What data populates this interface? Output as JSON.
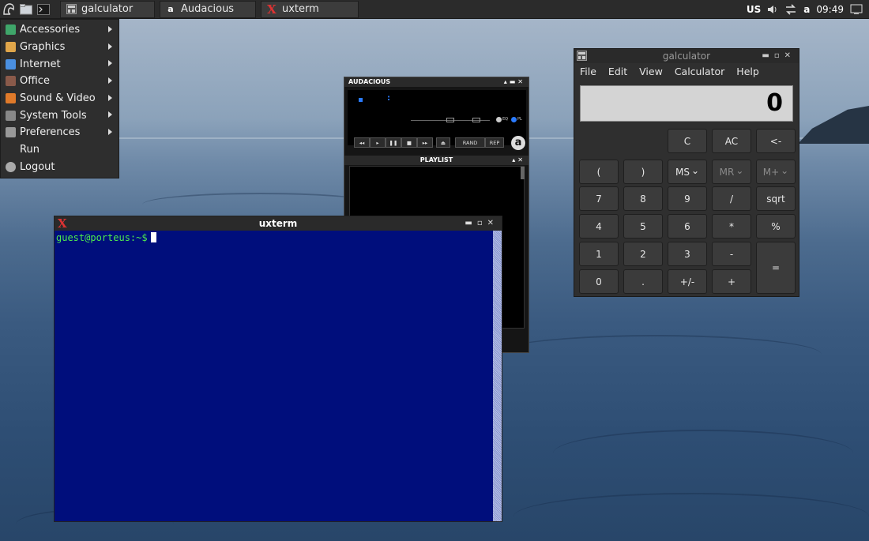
{
  "taskbar": {
    "tasks": [
      {
        "label": "galculator",
        "icon": "galculator-icon"
      },
      {
        "label": "Audacious",
        "icon": "audacious-icon",
        "glyph": "a"
      },
      {
        "label": "uxterm",
        "icon": "x-icon",
        "glyph": "X"
      }
    ],
    "keyboard_layout": "US",
    "tray_audacious_glyph": "a",
    "clock": "09:49"
  },
  "start_menu": {
    "items": [
      {
        "label": "Accessories",
        "submenu": true,
        "color": "#3fa66a"
      },
      {
        "label": "Graphics",
        "submenu": true,
        "color": "#e0a64a"
      },
      {
        "label": "Internet",
        "submenu": true,
        "color": "#4a8fe0"
      },
      {
        "label": "Office",
        "submenu": true,
        "color": "#8a5a4a"
      },
      {
        "label": "Sound & Video",
        "submenu": true,
        "color": "#e07a2a"
      },
      {
        "label": "System Tools",
        "submenu": true,
        "color": "#888888"
      },
      {
        "label": "Preferences",
        "submenu": true,
        "color": "#999999"
      },
      {
        "label": "Run",
        "submenu": false,
        "color": ""
      },
      {
        "label": "Logout",
        "submenu": false,
        "color": "#aaaaaa"
      }
    ]
  },
  "galculator": {
    "title": "galculator",
    "menu": [
      "File",
      "Edit",
      "View",
      "Calculator",
      "Help"
    ],
    "display": "0",
    "buttons": {
      "c": "C",
      "ac": "AC",
      "backspace": "<-",
      "paren_open": "(",
      "paren_close": ")",
      "ms": "MS",
      "mr": "MR",
      "mplus": "M+",
      "d7": "7",
      "d8": "8",
      "d9": "9",
      "div": "/",
      "sqrt": "sqrt",
      "d4": "4",
      "d5": "5",
      "d6": "6",
      "mul": "*",
      "pct": "%",
      "d1": "1",
      "d2": "2",
      "d3": "3",
      "sub": "-",
      "eq": "=",
      "d0": "0",
      "dot": ".",
      "sign": "+/-",
      "add": "+"
    }
  },
  "audacious": {
    "title": "AUDACIOUS",
    "time_separator": ":",
    "eq_label": "EQ",
    "pl_label": "PL",
    "rand_label": "RAND",
    "rep_label": "REP",
    "logo_glyph": "a",
    "playlist_title": "PLAYLIST"
  },
  "uxterm": {
    "title": "uxterm",
    "prompt": "guest@porteus:~$"
  }
}
